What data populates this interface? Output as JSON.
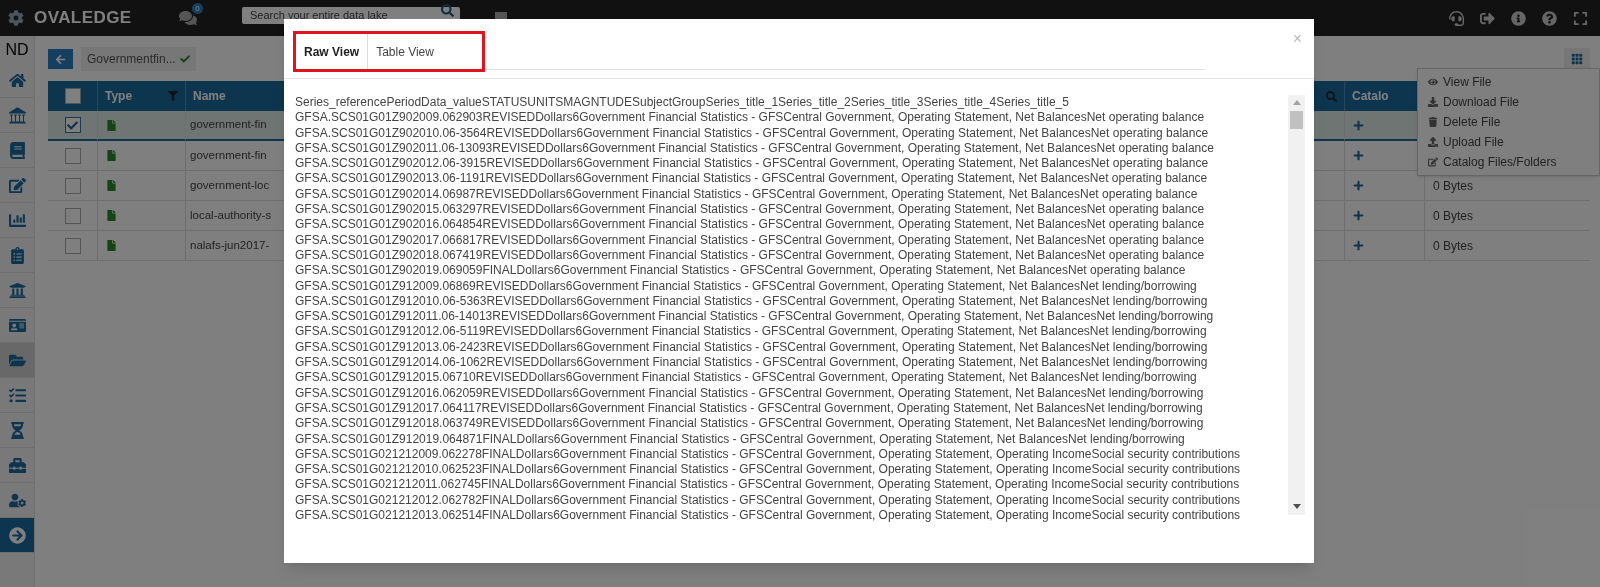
{
  "top_bar": {
    "logo": "OVALEDGE",
    "chat_badge": "0",
    "search": {
      "placeholder": "Search your entire data lake"
    }
  },
  "sidebar": {
    "user": "ND",
    "items": [
      {
        "kind": "home",
        "selected": false
      },
      {
        "kind": "library",
        "selected": false
      },
      {
        "kind": "book",
        "selected": false
      },
      {
        "kind": "edit",
        "selected": false
      },
      {
        "kind": "chart",
        "selected": false
      },
      {
        "kind": "clipboard",
        "selected": false
      },
      {
        "kind": "bank",
        "selected": false
      },
      {
        "kind": "card",
        "selected": false
      },
      {
        "kind": "folder",
        "selected": true
      },
      {
        "kind": "query",
        "selected": false
      },
      {
        "kind": "hourglass",
        "selected": false
      },
      {
        "kind": "toolbox",
        "selected": false
      },
      {
        "kind": "usercog",
        "selected": false
      },
      {
        "kind": "arrow",
        "selected": false
      }
    ]
  },
  "breadcrumb": {
    "label": "Governmentfin...",
    "verified": true
  },
  "table": {
    "all_checked": false,
    "columns": [
      "Type",
      "Name",
      "Catalo"
    ],
    "rows": [
      {
        "checked": true,
        "selected": true,
        "name": "government-fin"
      },
      {
        "checked": false,
        "selected": false,
        "name": "government-fin"
      },
      {
        "checked": false,
        "selected": false,
        "name": "government-loc",
        "size": "0 Bytes"
      },
      {
        "checked": false,
        "selected": false,
        "name": "local-authority-s",
        "size": "0 Bytes"
      },
      {
        "checked": false,
        "selected": false,
        "name": "nalafs-jun2017-",
        "size": "0 Bytes"
      }
    ]
  },
  "context_menu": {
    "items": [
      {
        "kind": "view",
        "label": "View File"
      },
      {
        "kind": "download",
        "label": "Download File"
      },
      {
        "kind": "delete",
        "label": "Delete File"
      },
      {
        "kind": "upload",
        "label": "Upload File"
      },
      {
        "kind": "catalog",
        "label": "Catalog Files/Folders"
      }
    ]
  },
  "modal": {
    "close": "×",
    "tabs": [
      {
        "label": "Raw View",
        "selected": true
      },
      {
        "label": "Table View",
        "selected": false
      }
    ],
    "lines": [
      "Series_referencePeriodData_valueSTATUSUNITSMAGNTUDESubjectGroupSeries_title_1Series_title_2Series_title_3Series_title_4Series_title_5",
      "GFSA.SCS01G01Z902009.062903REVISEDDollars6Government Financial Statistics - GFSCentral Government, Operating Statement, Net BalancesNet operating balance",
      "GFSA.SCS01G01Z902010.06-3564REVISEDDollars6Government Financial Statistics - GFSCentral Government, Operating Statement, Net BalancesNet operating balance",
      "GFSA.SCS01G01Z902011.06-13093REVISEDDollars6Government Financial Statistics - GFSCentral Government, Operating Statement, Net BalancesNet operating balance",
      "GFSA.SCS01G01Z902012.06-3915REVISEDDollars6Government Financial Statistics - GFSCentral Government, Operating Statement, Net BalancesNet operating balance",
      "GFSA.SCS01G01Z902013.06-1191REVISEDDollars6Government Financial Statistics - GFSCentral Government, Operating Statement, Net BalancesNet operating balance",
      "GFSA.SCS01G01Z902014.06987REVISEDDollars6Government Financial Statistics - GFSCentral Government, Operating Statement, Net BalancesNet operating balance",
      "GFSA.SCS01G01Z902015.063297REVISEDDollars6Government Financial Statistics - GFSCentral Government, Operating Statement, Net BalancesNet operating balance",
      "GFSA.SCS01G01Z902016.064854REVISEDDollars6Government Financial Statistics - GFSCentral Government, Operating Statement, Net BalancesNet operating balance",
      "GFSA.SCS01G01Z902017.066817REVISEDDollars6Government Financial Statistics - GFSCentral Government, Operating Statement, Net BalancesNet operating balance",
      "GFSA.SCS01G01Z902018.067419REVISEDDollars6Government Financial Statistics - GFSCentral Government, Operating Statement, Net BalancesNet operating balance",
      "GFSA.SCS01G01Z902019.069059FINALDollars6Government Financial Statistics - GFSCentral Government, Operating Statement, Net BalancesNet operating balance",
      "GFSA.SCS01G01Z912009.06869REVISEDDollars6Government Financial Statistics - GFSCentral Government, Operating Statement, Net BalancesNet lending/borrowing",
      "GFSA.SCS01G01Z912010.06-5363REVISEDDollars6Government Financial Statistics - GFSCentral Government, Operating Statement, Net BalancesNet lending/borrowing",
      "GFSA.SCS01G01Z912011.06-14013REVISEDDollars6Government Financial Statistics - GFSCentral Government, Operating Statement, Net BalancesNet lending/borrowing",
      "GFSA.SCS01G01Z912012.06-5119REVISEDDollars6Government Financial Statistics - GFSCentral Government, Operating Statement, Net BalancesNet lending/borrowing",
      "GFSA.SCS01G01Z912013.06-2423REVISEDDollars6Government Financial Statistics - GFSCentral Government, Operating Statement, Net BalancesNet lending/borrowing",
      "GFSA.SCS01G01Z912014.06-1062REVISEDDollars6Government Financial Statistics - GFSCentral Government, Operating Statement, Net BalancesNet lending/borrowing",
      "GFSA.SCS01G01Z912015.06710REVISEDDollars6Government Financial Statistics - GFSCentral Government, Operating Statement, Net BalancesNet lending/borrowing",
      "GFSA.SCS01G01Z912016.062059REVISEDDollars6Government Financial Statistics - GFSCentral Government, Operating Statement, Net BalancesNet lending/borrowing",
      "GFSA.SCS01G01Z912017.064117REVISEDDollars6Government Financial Statistics - GFSCentral Government, Operating Statement, Net BalancesNet lending/borrowing",
      "GFSA.SCS01G01Z912018.063749REVISEDDollars6Government Financial Statistics - GFSCentral Government, Operating Statement, Net BalancesNet lending/borrowing",
      "GFSA.SCS01G01Z912019.064871FINALDollars6Government Financial Statistics - GFSCentral Government, Operating Statement, Net BalancesNet lending/borrowing",
      "GFSA.SCS01G021212009.062278FINALDollars6Government Financial Statistics - GFSCentral Government, Operating Statement, Operating IncomeSocial security contributions",
      "GFSA.SCS01G021212010.062523FINALDollars6Government Financial Statistics - GFSCentral Government, Operating Statement, Operating IncomeSocial security contributions",
      "GFSA.SCS01G021212011.062745FINALDollars6Government Financial Statistics - GFSCentral Government, Operating Statement, Operating IncomeSocial security contributions",
      "GFSA.SCS01G021212012.062782FINALDollars6Government Financial Statistics - GFSCentral Government, Operating Statement, Operating IncomeSocial security contributions",
      "GFSA.SCS01G021212013.062514FINALDollars6Government Financial Statistics - GFSCentral Government, Operating Statement, Operating IncomeSocial security contributions"
    ]
  }
}
